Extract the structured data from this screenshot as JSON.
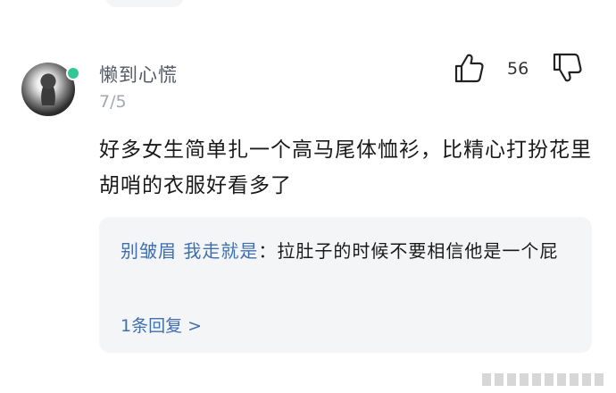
{
  "comment": {
    "username": "懒到心慌",
    "date": "7/5",
    "like_count": "56",
    "text": "好多女生简单扎一个高马尾体恤衫，比精心打扮花里胡哨的衣服好看多了",
    "avatar": "avatar-image",
    "online_status_color": "#2ec795"
  },
  "reply": {
    "author": "别皱眉 我走就是",
    "separator": "：",
    "text": "拉肚子的时候不要相信他是一个屁",
    "more_label": "1条回复 >"
  },
  "icons": {
    "like": "thumbs-up-icon",
    "dislike": "thumbs-down-icon"
  },
  "colors": {
    "link_blue": "#3f6fb0",
    "reply_bg": "#f4f5f7",
    "muted_text": "#a3a7b0"
  }
}
